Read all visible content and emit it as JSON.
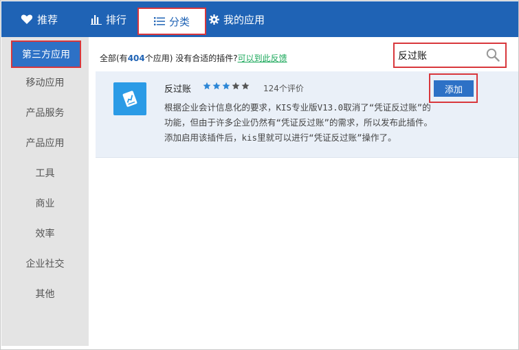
{
  "nav": {
    "recommend": "推荐",
    "rank": "排行",
    "category": "分类",
    "my_apps": "我的应用"
  },
  "sidebar": {
    "items": [
      {
        "label": "第三方应用",
        "active": true
      },
      {
        "label": "移动应用"
      },
      {
        "label": "产品服务"
      },
      {
        "label": "产品应用"
      },
      {
        "label": "工具"
      },
      {
        "label": "商业"
      },
      {
        "label": "效率"
      },
      {
        "label": "企业社交"
      },
      {
        "label": "其他"
      }
    ]
  },
  "summary": {
    "prefix": "全部(有",
    "count": "404",
    "suffix": "个应用) 没有合适的插件?",
    "link": "可以到此反馈"
  },
  "search": {
    "value": "反过账"
  },
  "app": {
    "title": "反过账",
    "rating": 3,
    "max_rating": 5,
    "reviews": "124个评价",
    "description": "根据企业会计信息化的要求，KIS专业版V13.0取消了“凭证反过账”的功能，但由于许多企业仍然有“凭证反过账”的需求，所以发布此插件。添加启用该插件后，kis里就可以进行“凭证反过账”操作了。",
    "add_label": "添加"
  },
  "colors": {
    "nav_bg": "#1f63b5",
    "accent": "#2d71c6",
    "highlight_border": "#d8363b",
    "link": "#1aa85a",
    "star_on": "#2b86d6",
    "star_off": "#555555"
  }
}
